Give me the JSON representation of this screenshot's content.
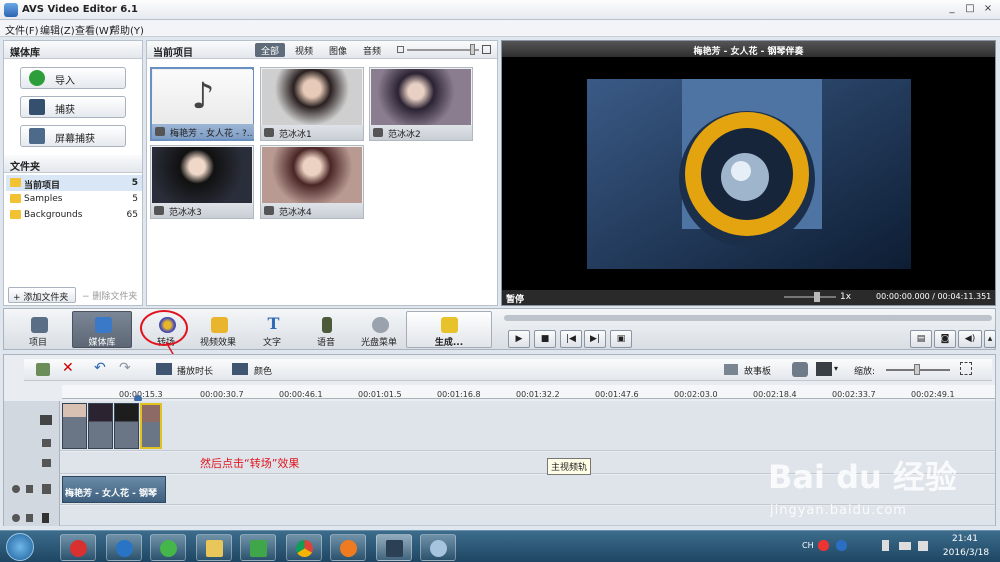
{
  "window": {
    "title": "AVS Video Editor 6.1",
    "controls": [
      "_",
      "□",
      "×"
    ]
  },
  "menubar": [
    "文件(F)",
    "编辑(Z)",
    "查看(W)",
    "帮助(Y)"
  ],
  "media_panel": {
    "header": "媒体库",
    "buttons": [
      "导入",
      "捕获",
      "屏幕捕获"
    ],
    "folders_header": "文件夹",
    "folders": [
      {
        "name": "当前项目",
        "count": "5"
      },
      {
        "name": "Samples",
        "count": "5"
      },
      {
        "name": "Backgrounds",
        "count": "65"
      }
    ],
    "add_folder": "+ 添加文件夹",
    "delete_folder": "− 删除文件夹"
  },
  "project_panel": {
    "header": "当前项目",
    "tabs": [
      "全部",
      "视频",
      "图像",
      "音频"
    ],
    "items": [
      {
        "label": "梅艳芳 - 女人花 - ?..",
        "type": "audio"
      },
      {
        "label": "范冰冰1",
        "type": "image"
      },
      {
        "label": "范冰冰2",
        "type": "image"
      },
      {
        "label": "范冰冰3",
        "type": "image"
      },
      {
        "label": "范冰冰4",
        "type": "image"
      }
    ]
  },
  "preview": {
    "title": "梅艳芳 - 女人花 - 钢琴伴奏",
    "status": "暂停",
    "speed": "1x",
    "time": "00:00:00.000 / 00:04:11.351"
  },
  "toolbar": {
    "buttons": [
      "项目",
      "媒体库",
      "转场",
      "视频效果",
      "文字",
      "语音",
      "光盘菜单",
      "生成..."
    ],
    "active": "媒体库"
  },
  "timeline": {
    "duration_btn": "播放时长",
    "color_btn": "颜色",
    "storyboard": "故事板",
    "zoom_label": "缩放:",
    "ruler": [
      "00:00:15.3",
      "00:00:30.7",
      "00:00:46.1",
      "00:01:01.5",
      "00:01:16.8",
      "00:01:32.2",
      "00:01:47.6",
      "00:02:03.0",
      "00:02:18.4",
      "00:02:33.7",
      "00:02:49.1"
    ],
    "audio_clip": "梅艳芳 - 女人花 - 钢琴",
    "tooltip": "主视频轨"
  },
  "annotation": {
    "text": "然后点击“转场”效果",
    "color": "#e0141e"
  },
  "taskbar": {
    "time": "21:41",
    "date": "2016/3/18",
    "lang": "CH"
  },
  "watermark": {
    "logo": "Bai du 经验",
    "url": "jingyan.baidu.com"
  }
}
